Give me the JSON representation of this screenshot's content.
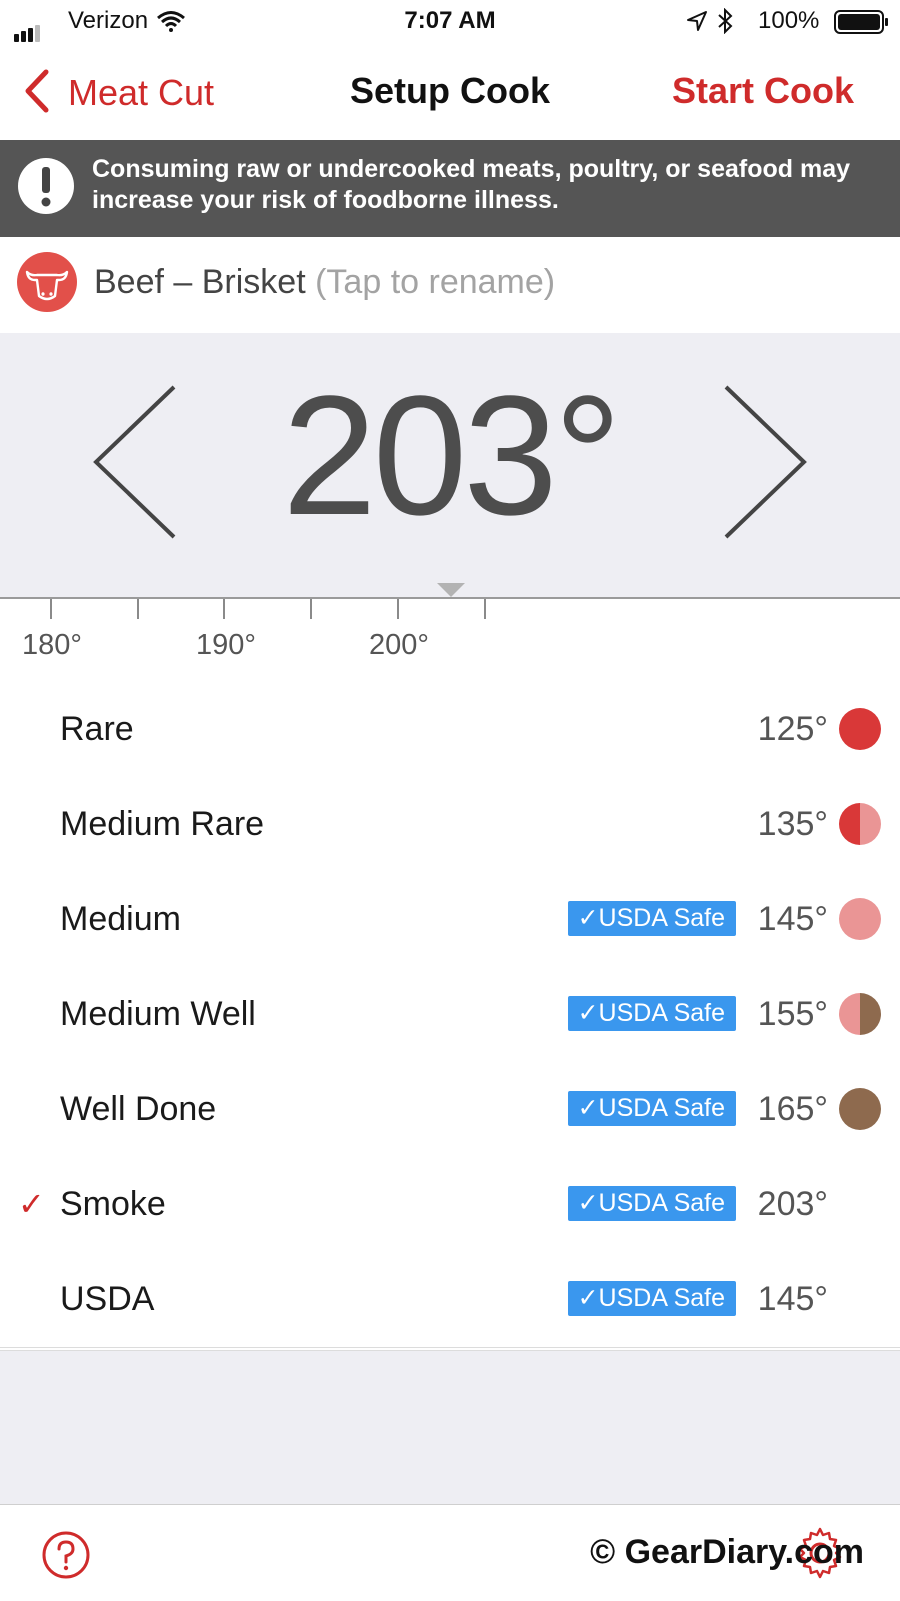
{
  "status_bar": {
    "carrier": "Verizon",
    "time": "7:07 AM",
    "battery": "100%"
  },
  "nav": {
    "back_label": "Meat Cut",
    "title": "Setup Cook",
    "action_label": "Start Cook"
  },
  "warning": {
    "text": "Consuming raw or undercooked meats, poultry, or seafood may increase your risk of foodborne illness."
  },
  "meat": {
    "name": "Beef – Brisket",
    "rename_hint": "(Tap to rename)"
  },
  "picker": {
    "temperature": "203°",
    "ruler_labels": [
      "180°",
      "190°",
      "200°"
    ]
  },
  "doneness": [
    {
      "label": "Rare",
      "temp": "125°",
      "usda_safe": false,
      "selected": false,
      "badge": ""
    },
    {
      "label": "Medium Rare",
      "temp": "135°",
      "usda_safe": false,
      "selected": false,
      "badge": ""
    },
    {
      "label": "Medium",
      "temp": "145°",
      "usda_safe": true,
      "selected": false,
      "badge": "✓USDA Safe"
    },
    {
      "label": "Medium Well",
      "temp": "155°",
      "usda_safe": true,
      "selected": false,
      "badge": "✓USDA Safe"
    },
    {
      "label": "Well Done",
      "temp": "165°",
      "usda_safe": true,
      "selected": false,
      "badge": "✓USDA Safe"
    },
    {
      "label": "Smoke",
      "temp": "203°",
      "usda_safe": true,
      "selected": true,
      "badge": "✓USDA Safe"
    },
    {
      "label": "USDA",
      "temp": "145°",
      "usda_safe": true,
      "selected": false,
      "badge": "✓USDA Safe"
    }
  ],
  "selected_mark": "✓",
  "footer": {
    "watermark": "© GearDiary.com"
  },
  "colors": {
    "accent_red": "#cf2b2b",
    "warning_bg": "#555555",
    "badge_blue": "#3a97ee",
    "rare": "#d93838",
    "medium": "#ea9595",
    "well_done": "#8e6a4e"
  }
}
